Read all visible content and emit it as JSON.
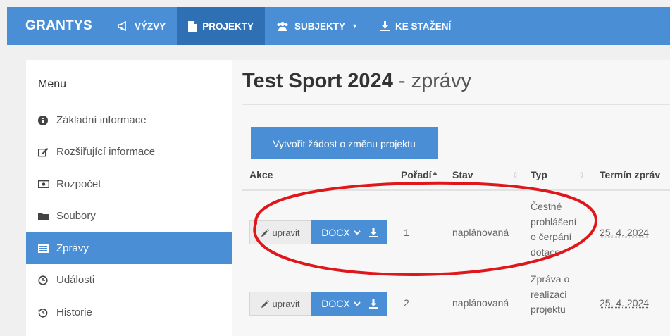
{
  "navbar": {
    "brand": "GRANTYS",
    "items": [
      {
        "label": "VÝZVY",
        "icon": "megaphone-icon"
      },
      {
        "label": "PROJEKTY",
        "icon": "document-icon",
        "active": true
      },
      {
        "label": "SUBJEKTY",
        "icon": "users-icon",
        "dropdown": true
      },
      {
        "label": "KE STAŽENÍ",
        "icon": "download-icon"
      }
    ]
  },
  "sidebar": {
    "title": "Menu",
    "items": [
      {
        "label": "Základní informace",
        "icon": "info-icon"
      },
      {
        "label": "Rozšiřující informace",
        "icon": "edit-icon"
      },
      {
        "label": "Rozpočet",
        "icon": "money-icon"
      },
      {
        "label": "Soubory",
        "icon": "folder-icon"
      },
      {
        "label": "Zprávy",
        "icon": "list-icon",
        "active": true
      },
      {
        "label": "Události",
        "icon": "clock-icon"
      },
      {
        "label": "Historie",
        "icon": "history-icon"
      }
    ]
  },
  "main": {
    "title_bold": "Test Sport 2024",
    "title_rest": " - zprávy",
    "change_button": "Vytvořit žádost o změnu projektu",
    "columns": [
      "Akce",
      "Pořadí",
      "Stav",
      "Typ",
      "Termín zpráv"
    ],
    "rows": [
      {
        "edit_label": "upravit",
        "docx_label": "DOCX",
        "order": "1",
        "status": "naplánovaná",
        "type_lines": [
          "Čestné",
          "prohlášení",
          "o čerpání",
          "dotace"
        ],
        "date": "25. 4. 2024"
      },
      {
        "edit_label": "upravit",
        "docx_label": "DOCX",
        "order": "2",
        "status": "naplánovaná",
        "type_lines": [
          "Zpráva o",
          "realizaci",
          "projektu"
        ],
        "date": "25. 4. 2024"
      }
    ]
  },
  "colors": {
    "navbar": "#4a8fd6",
    "navbar_active": "#2f6fb3",
    "annotation": "#e0161b"
  }
}
